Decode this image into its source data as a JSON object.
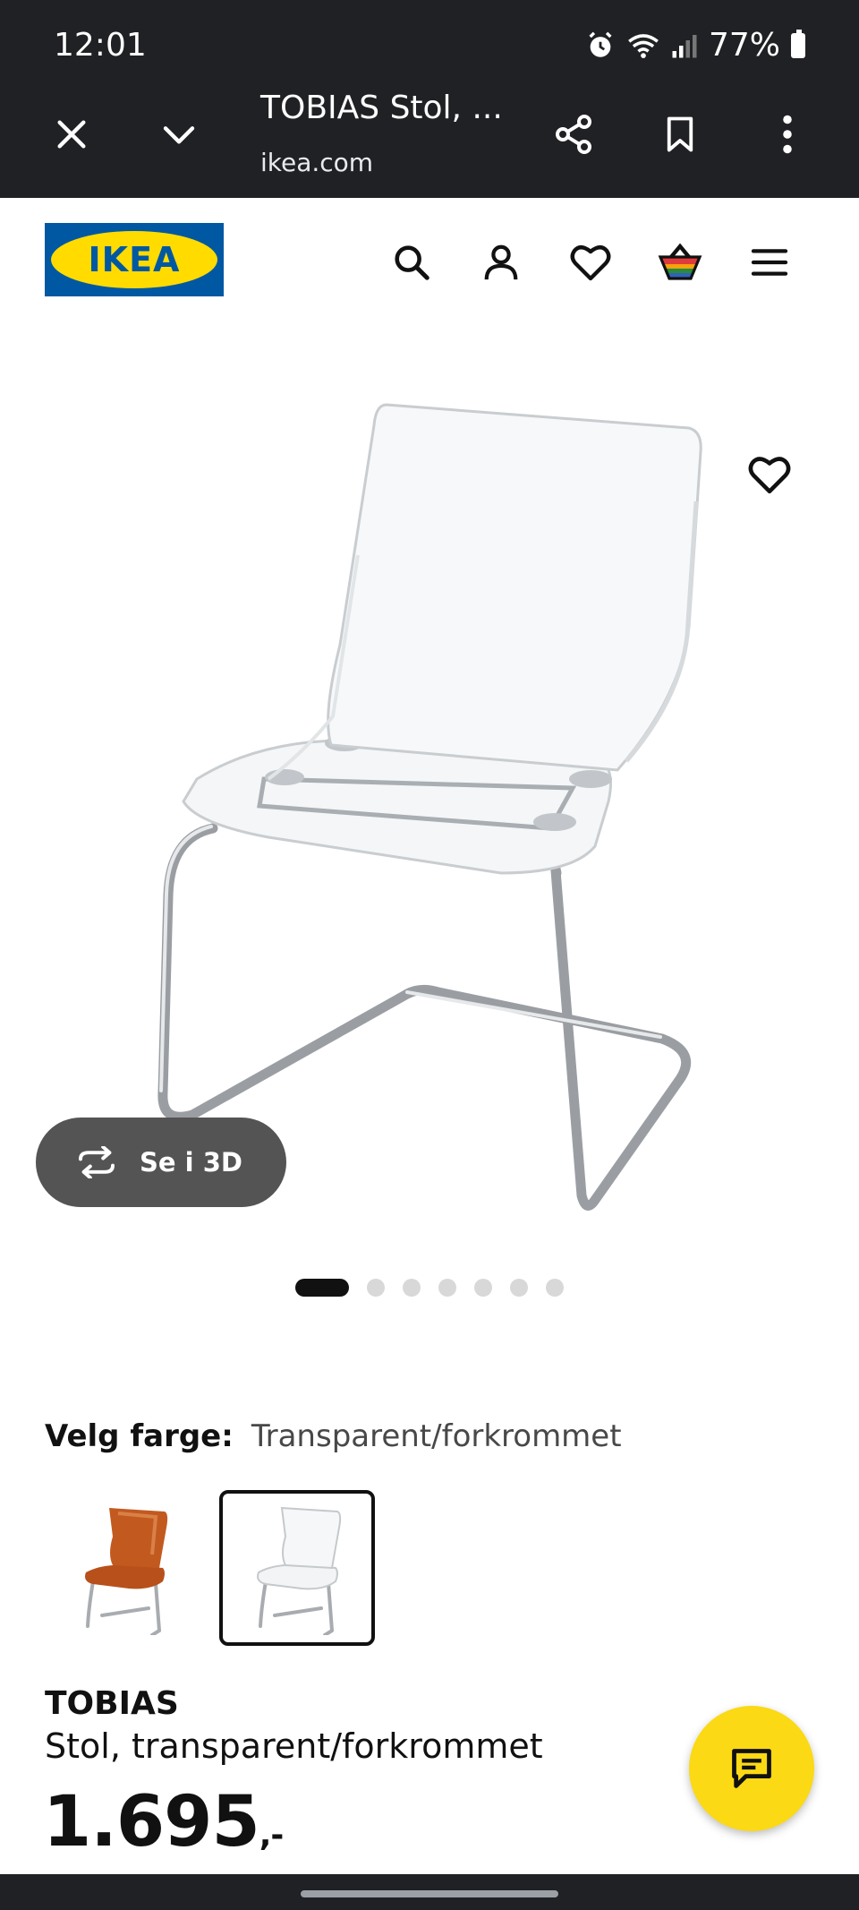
{
  "status_bar": {
    "time": "12:01",
    "battery": "77%",
    "icons": [
      "alarm-icon",
      "wifi-icon",
      "signal-icon",
      "battery-icon"
    ]
  },
  "browser": {
    "title": "TOBIAS Stol, ...",
    "url": "ikea.com",
    "icons": [
      "close-icon",
      "chevron-down-icon",
      "share-icon",
      "bookmark-icon",
      "more-vert-icon"
    ]
  },
  "site_header": {
    "logo_text": "IKEA",
    "icons": [
      "search-icon",
      "account-icon",
      "heart-icon",
      "basket-icon",
      "menu-icon"
    ],
    "colors": {
      "logo_blue": "#0058a3",
      "logo_yellow": "#ffdb00"
    }
  },
  "gallery": {
    "view_3d_label": "Se i 3D",
    "image_count": 7,
    "active_index": 0
  },
  "color_selector": {
    "label": "Velg farge:",
    "selected": "Transparent/forkrommet",
    "options": [
      "orange-chair-thumbnail",
      "transparent-chair-thumbnail"
    ],
    "selected_index": 1
  },
  "product": {
    "name": "TOBIAS",
    "description": "Stol, transparent/forkrommet",
    "price": "1.695",
    "price_suffix": ",-"
  },
  "chat": {
    "icon": "chat-icon",
    "color": "#fbd914"
  }
}
